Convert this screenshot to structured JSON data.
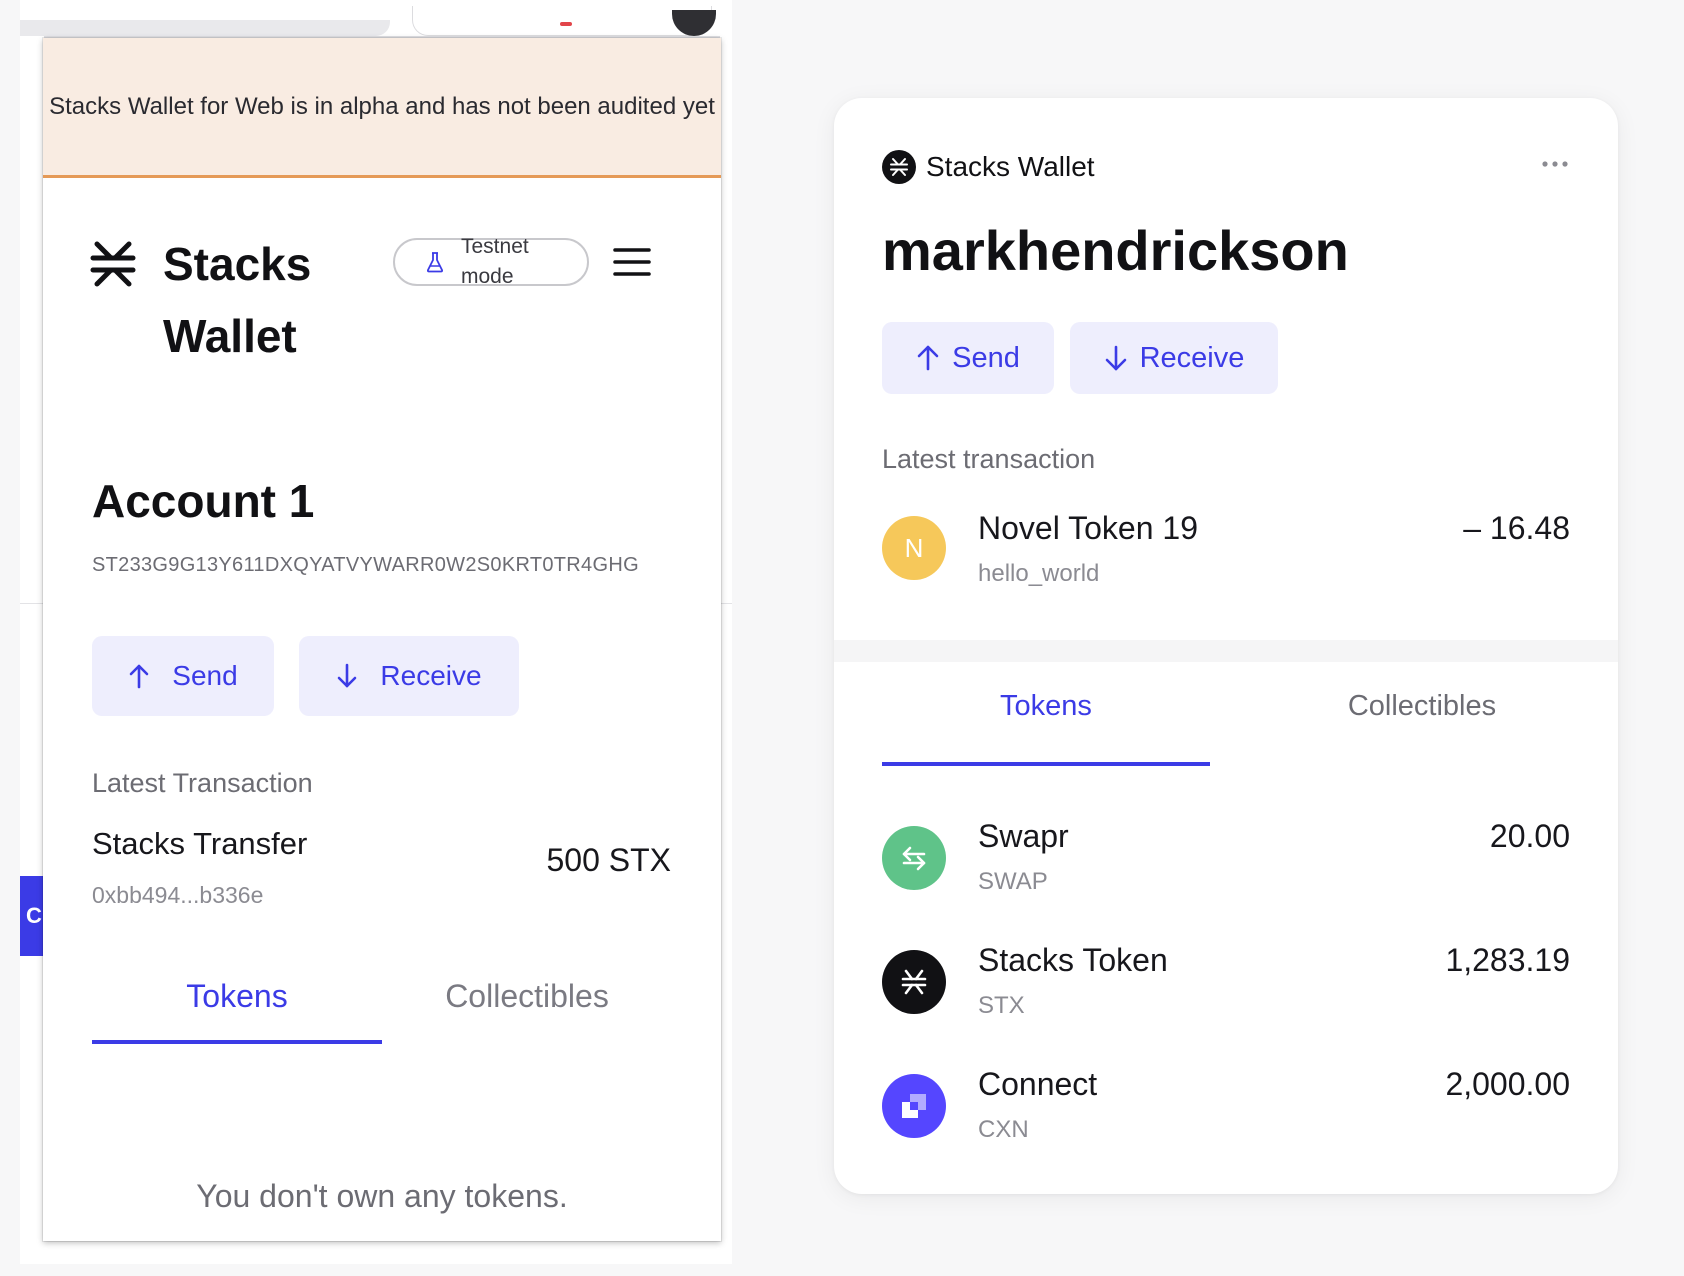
{
  "popup": {
    "alpha_banner": "Stacks Wallet for Web is in alpha and has not been audited yet",
    "brand": "Stacks Wallet",
    "testnet_badge": "Testnet mode",
    "account_title": "Account 1",
    "account_address": "ST233G9G13Y611DXQYATVYWARR0W2S0KRT0TR4GHG",
    "send_label": "Send",
    "receive_label": "Receive",
    "latest_label": "Latest Transaction",
    "latest_tx": {
      "title": "Stacks Transfer",
      "hash": "0xbb494...b336e",
      "amount": "500 STX"
    },
    "tabs": {
      "tokens": "Tokens",
      "collectibles": "Collectibles"
    },
    "empty_state": "You don't own any tokens.",
    "side_tab_letter": "C"
  },
  "card": {
    "app_name": "Stacks Wallet",
    "username": "markhendrickson",
    "send_label": "Send",
    "receive_label": "Receive",
    "latest_label": "Latest transaction",
    "latest_tx": {
      "avatar_letter": "N",
      "avatar_color": "#f6c85a",
      "name": "Novel Token 19",
      "sub": "hello_world",
      "amount": "– 16.48"
    },
    "tabs": {
      "tokens": "Tokens",
      "collectibles": "Collectibles"
    },
    "tokens": [
      {
        "name": "Swapr",
        "symbol": "SWAP",
        "amount": "20.00",
        "icon": "swap-arrows-icon",
        "color": "#5fc389"
      },
      {
        "name": "Stacks Token",
        "symbol": "STX",
        "amount": "1,283.19",
        "icon": "stacks-icon",
        "color": "#111114"
      },
      {
        "name": "Connect",
        "symbol": "CXN",
        "amount": "2,000.00",
        "icon": "connect-icon",
        "color": "#5546ff"
      }
    ]
  },
  "colors": {
    "accent": "#3b3be6",
    "button_bg": "#eeeefd",
    "banner_bg": "#f9ece2",
    "banner_border": "#e59a57"
  }
}
